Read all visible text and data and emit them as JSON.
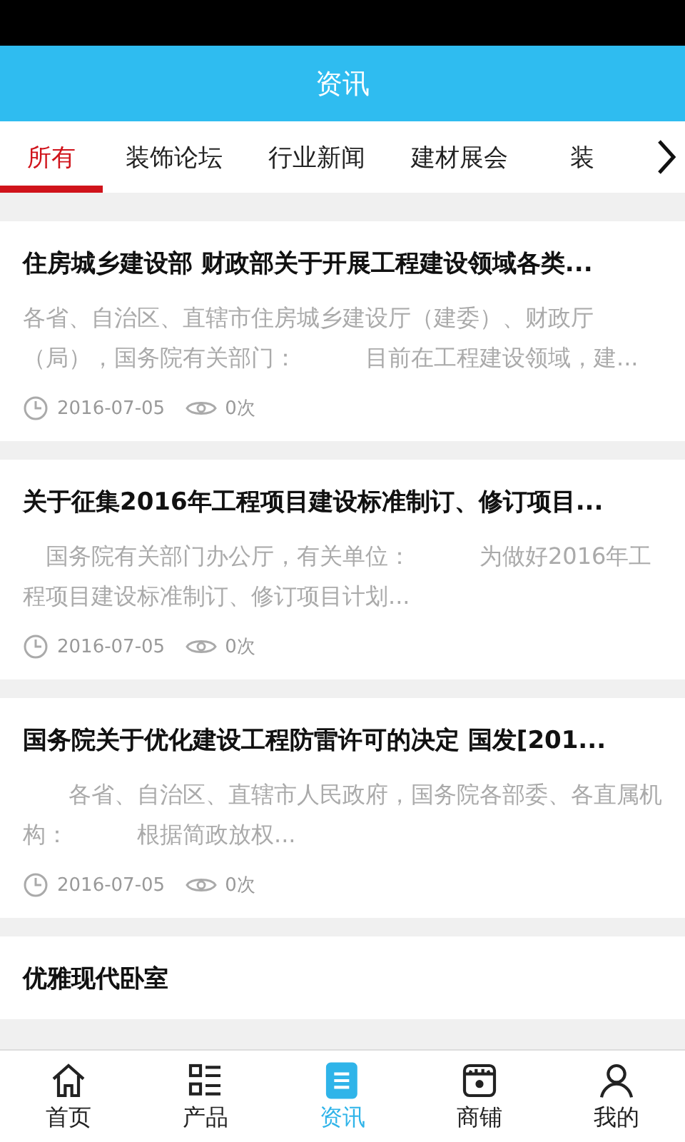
{
  "header": {
    "title": "资讯"
  },
  "tabs": [
    {
      "label": "所有",
      "selected": true
    },
    {
      "label": "装饰论坛",
      "selected": false
    },
    {
      "label": "行业新闻",
      "selected": false
    },
    {
      "label": "建材展会",
      "selected": false
    },
    {
      "label": "装",
      "selected": false
    }
  ],
  "articles": [
    {
      "title": "住房城乡建设部 财政部关于开展工程建设领域各类...",
      "excerpt": "各省、自治区、直辖市住房城乡建设厅（建委）、财政厅（局），国务院有关部门：　　　目前在工程建设领域，建...",
      "date": "2016-07-05",
      "views": "0次"
    },
    {
      "title": "关于征集2016年工程项目建设标准制订、修订项目...",
      "excerpt": "　国务院有关部门办公厅，有关单位：　　　为做好2016年工程项目建设标准制订、修订项目计划...",
      "date": "2016-07-05",
      "views": "0次"
    },
    {
      "title": "国务院关于优化建设工程防雷许可的决定 国发[201...",
      "excerpt": "　　各省、自治区、直辖市人民政府，国务院各部委、各直属机构：　　　根据简政放权...",
      "date": "2016-07-05",
      "views": "0次"
    },
    {
      "title": "优雅现代卧室"
    }
  ],
  "nav": [
    {
      "kind": "home",
      "label": "首页",
      "selected": false
    },
    {
      "kind": "products",
      "label": "产品",
      "selected": false
    },
    {
      "kind": "news",
      "label": "资讯",
      "selected": true
    },
    {
      "kind": "shop",
      "label": "商铺",
      "selected": false
    },
    {
      "kind": "profile",
      "label": "我的",
      "selected": false
    }
  ]
}
